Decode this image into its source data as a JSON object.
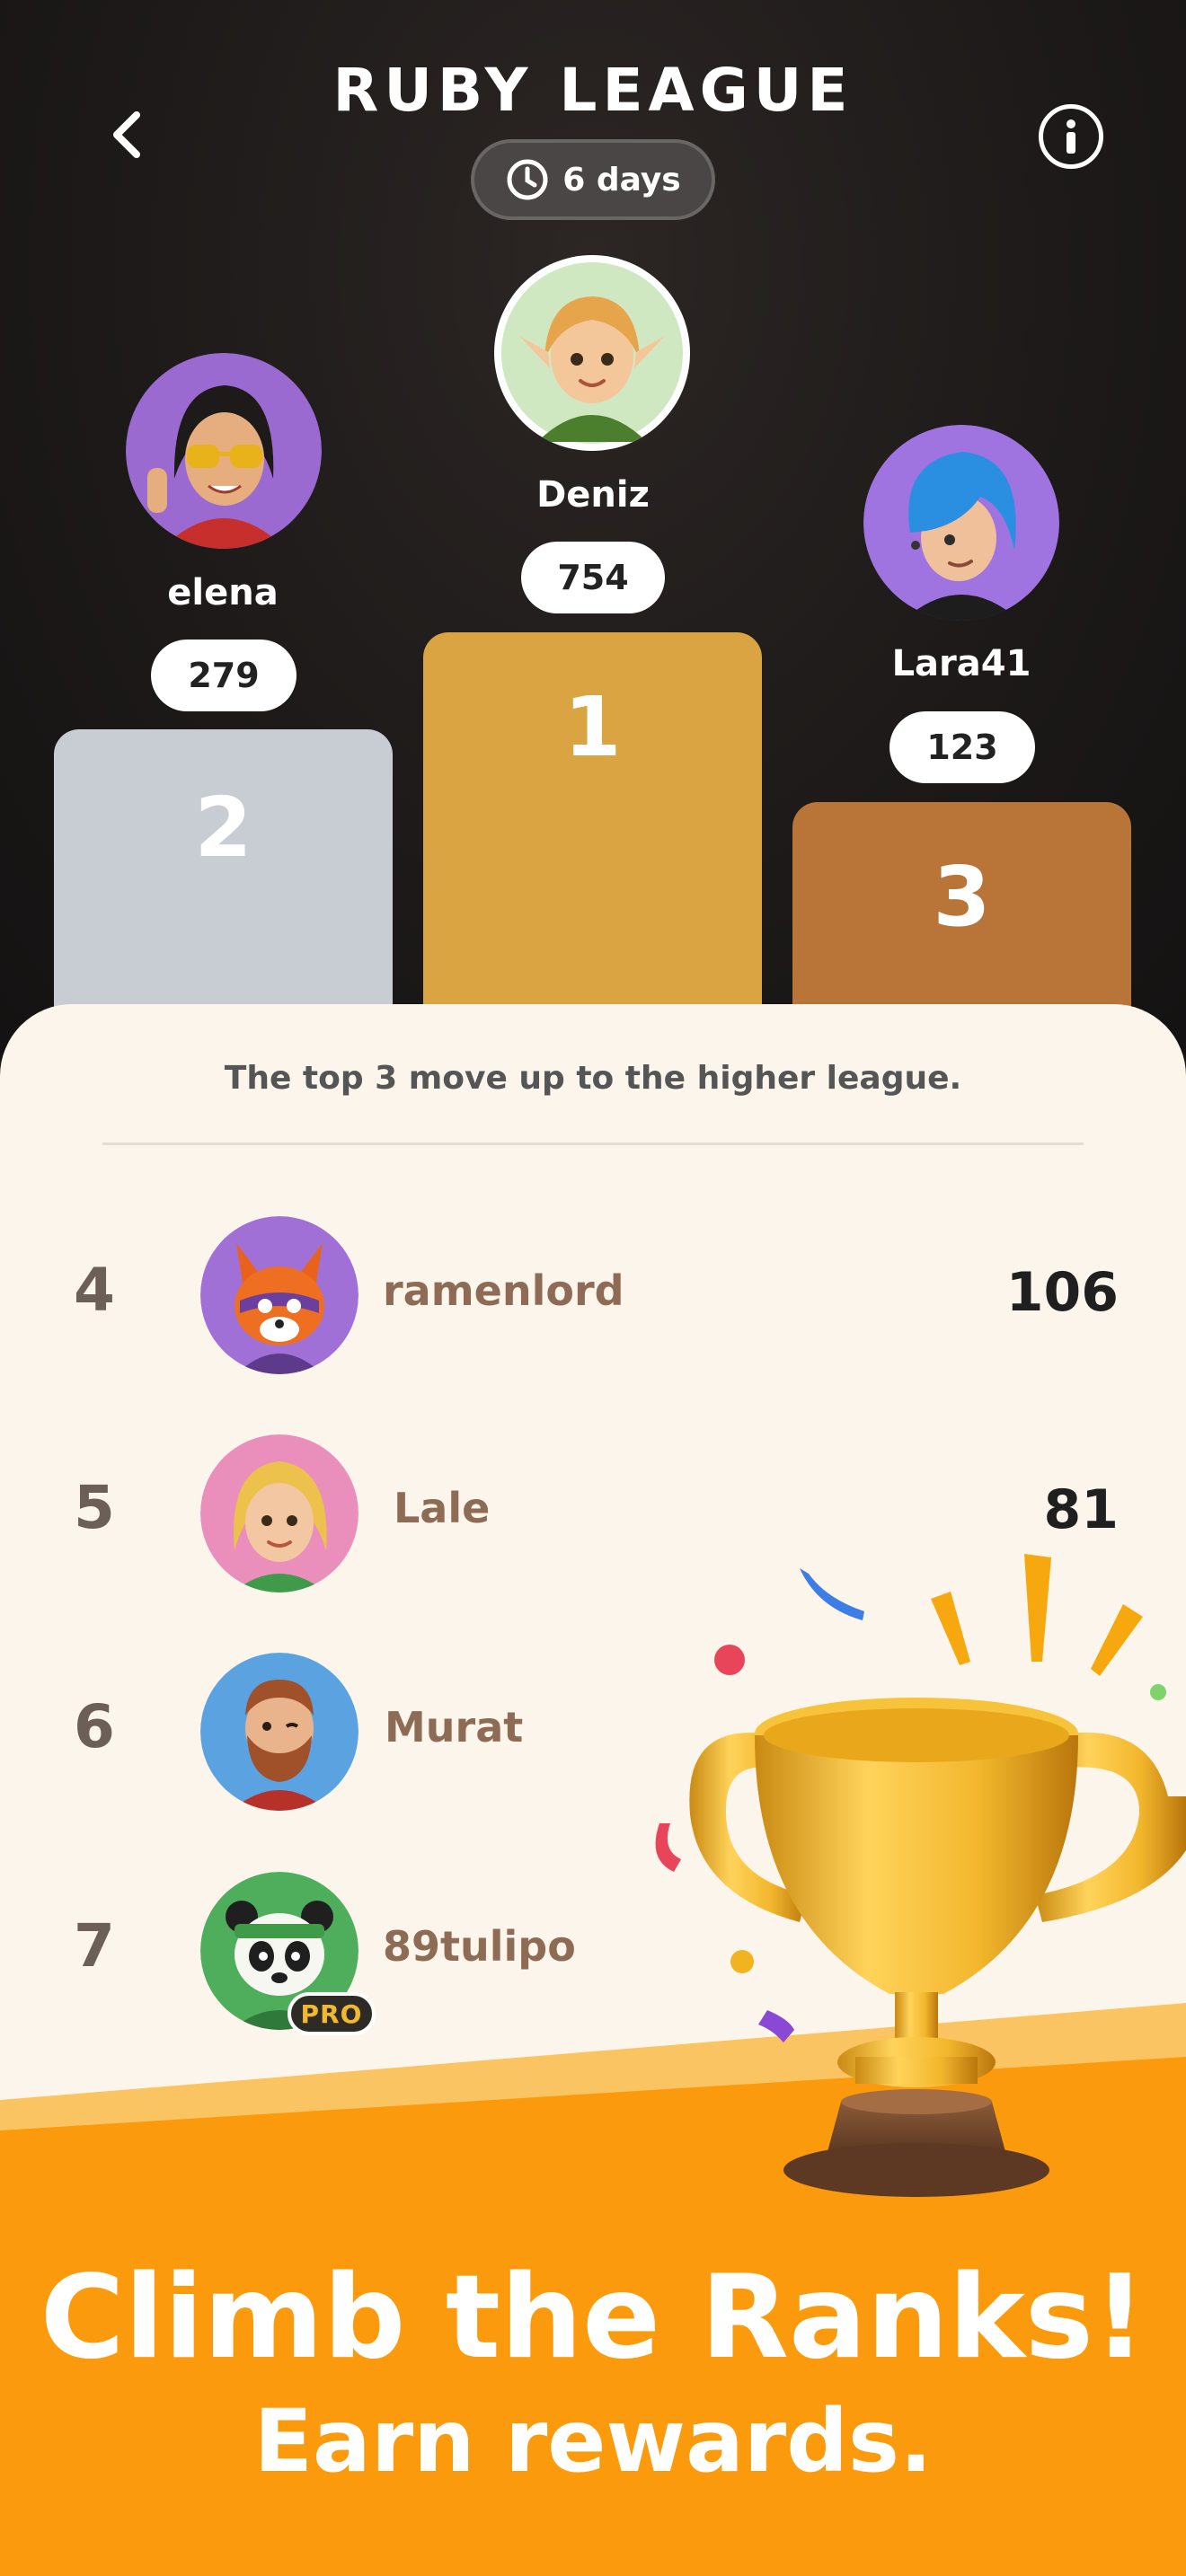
{
  "header": {
    "title": "RUBY LEAGUE",
    "timer": "6 days"
  },
  "icons": {
    "back": "chevron-left-icon",
    "info": "info-icon",
    "timer": "clock-icon"
  },
  "podium": {
    "first": {
      "rank": "1",
      "name": "Deniz",
      "score": "754"
    },
    "second": {
      "rank": "2",
      "name": "elena",
      "score": "279"
    },
    "third": {
      "rank": "3",
      "name": "Lara41",
      "score": "123"
    }
  },
  "panel": {
    "rule_text": "The top 3 move up to the higher league."
  },
  "leaderboard": [
    {
      "rank": "4",
      "name": "ramenlord",
      "score": "106"
    },
    {
      "rank": "5",
      "name": "Lale",
      "score": "81"
    },
    {
      "rank": "6",
      "name": "Murat",
      "score": ""
    },
    {
      "rank": "7",
      "name": "89tulipo",
      "score": "",
      "badge": "PRO"
    }
  ],
  "promo": {
    "headline": "Climb the Ranks!",
    "subline": "Earn rewards."
  },
  "colors": {
    "podium_gold": "#d9a441",
    "podium_silver": "#c8ccd3",
    "podium_bronze": "#b97537",
    "orange": "#fb9a0c",
    "panel_bg": "#fcf5ec"
  }
}
